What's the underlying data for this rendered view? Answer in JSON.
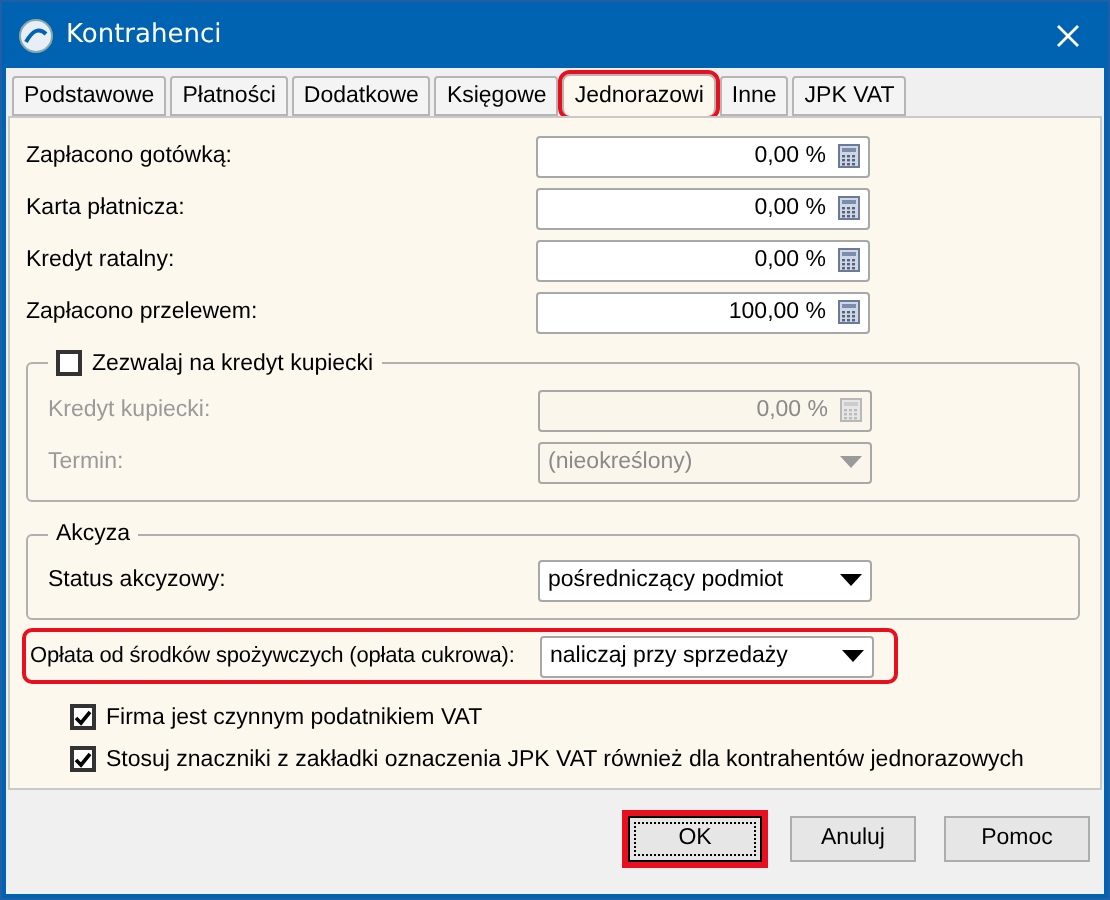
{
  "window": {
    "title": "Kontrahenci"
  },
  "tabs": [
    {
      "label": "Podstawowe",
      "selected": false,
      "highlighted": false
    },
    {
      "label": "Płatności",
      "selected": false,
      "highlighted": false
    },
    {
      "label": "Dodatkowe",
      "selected": false,
      "highlighted": false
    },
    {
      "label": "Księgowe",
      "selected": false,
      "highlighted": false
    },
    {
      "label": "Jednorazowi",
      "selected": true,
      "highlighted": true
    },
    {
      "label": "Inne",
      "selected": false,
      "highlighted": false
    },
    {
      "label": "JPK VAT",
      "selected": false,
      "highlighted": false
    }
  ],
  "payment_fields": [
    {
      "label": "Zapłacono gotówką:",
      "value": "0,00 %"
    },
    {
      "label": "Karta płatnicza:",
      "value": "0,00 %"
    },
    {
      "label": "Kredyt ratalny:",
      "value": "0,00 %"
    },
    {
      "label": "Zapłacono przelewem:",
      "value": "100,00 %"
    }
  ],
  "merchant_credit": {
    "label": "Zezwalaj na kredyt kupiecki",
    "checked": false,
    "fields": [
      {
        "kind": "number",
        "label": "Kredyt kupiecki:",
        "value": "0,00 %",
        "disabled": true
      },
      {
        "kind": "dropdown",
        "label": "Termin:",
        "value": "(nieokreślony)",
        "disabled": true
      }
    ]
  },
  "excise": {
    "title": "Akcyza",
    "label": "Status akcyzowy:",
    "value": "pośredniczący podmiot"
  },
  "sugar_fee": {
    "label": "Opłata od środków spożywczych (opłata cukrowa):",
    "value": "naliczaj przy sprzedaży",
    "highlighted": true
  },
  "checkboxes": [
    {
      "label": "Firma jest czynnym podatnikiem VAT",
      "checked": true
    },
    {
      "label": "Stosuj znaczniki z zakładki oznaczenia JPK VAT również dla kontrahentów jednorazowych",
      "checked": true
    }
  ],
  "buttons": [
    {
      "label": "OK",
      "default": true,
      "highlighted": true
    },
    {
      "label": "Anuluj",
      "default": false,
      "highlighted": false
    },
    {
      "label": "Pomoc",
      "default": false,
      "highlighted": false
    }
  ]
}
